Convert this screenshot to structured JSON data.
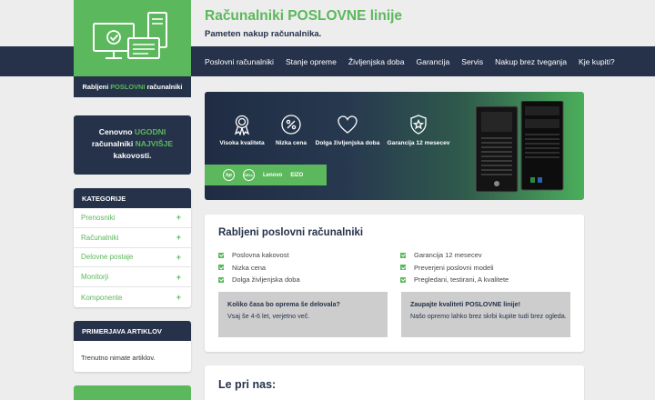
{
  "header": {
    "title": "Računalniki POSLOVNE linije",
    "subtitle": "Pameten nakup računalnika."
  },
  "nav": {
    "items": [
      "Poslovni računalniki",
      "Stanje opreme",
      "Življenjska doba",
      "Garancija",
      "Servis",
      "Nakup brez tveganja",
      "Kje kupiti?"
    ]
  },
  "logo": {
    "caption_pre": "Rabljeni",
    "caption_highlight": "POSLOVNI",
    "caption_post": "računalniki"
  },
  "promo": {
    "w1": "Cenovno",
    "w2": "UGODNI",
    "w3": "računalniki",
    "w4": "NAJVIŠJE",
    "w5": "kakovosti."
  },
  "categories": {
    "heading": "KATEGORIJE",
    "items": [
      {
        "label": "Prenosniki",
        "toggle": "+"
      },
      {
        "label": "Računalniki",
        "toggle": "+"
      },
      {
        "label": "Delovne postaje",
        "toggle": "+"
      },
      {
        "label": "Monitorji",
        "toggle": "+"
      },
      {
        "label": "Komponente",
        "toggle": "+"
      }
    ]
  },
  "compare": {
    "heading": "PRIMERJAVA ARTIKLOV",
    "empty_text": "Trenutno nimate artiklov."
  },
  "banner": {
    "features": [
      {
        "label": "Visoka kvaliteta",
        "icon": "award-ribbon-icon"
      },
      {
        "label": "Nizka cena",
        "icon": "percent-badge-icon"
      },
      {
        "label": "Dolga življenjska doba",
        "icon": "heart-icon"
      },
      {
        "label": "Garancija 12 mesecev",
        "icon": "shield-star-icon"
      }
    ],
    "brands": {
      "hp": "hp",
      "dell": "DELL",
      "lenovo": "Lenovo",
      "eizo": "EIZO"
    }
  },
  "main_card": {
    "title": "Rabljeni poslovni računalniki",
    "left_checks": [
      "Poslovna kakovost",
      "Nizka cena",
      "Dolga življenjska doba"
    ],
    "right_checks": [
      "Garancija 12 mesecev",
      "Preverjeni poslovni modeli",
      "Pregledani, testirani, A kvalitete"
    ],
    "info_left": {
      "title": "Koliko časa bo oprema še delovala?",
      "text": "Vsaj še 4-6 let, verjetno več."
    },
    "info_right": {
      "title": "Zaupajte kvaliteti POSLOVNE linije!",
      "text": "Našo opremo lahko brez skrbi kupite tudi brez ogleda."
    }
  },
  "second_card": {
    "title": "Le pri nas:"
  },
  "colors": {
    "accent_green": "#5cb85c",
    "navy": "#25324a",
    "background": "#ededed",
    "info_gray": "#cdcdcd"
  }
}
